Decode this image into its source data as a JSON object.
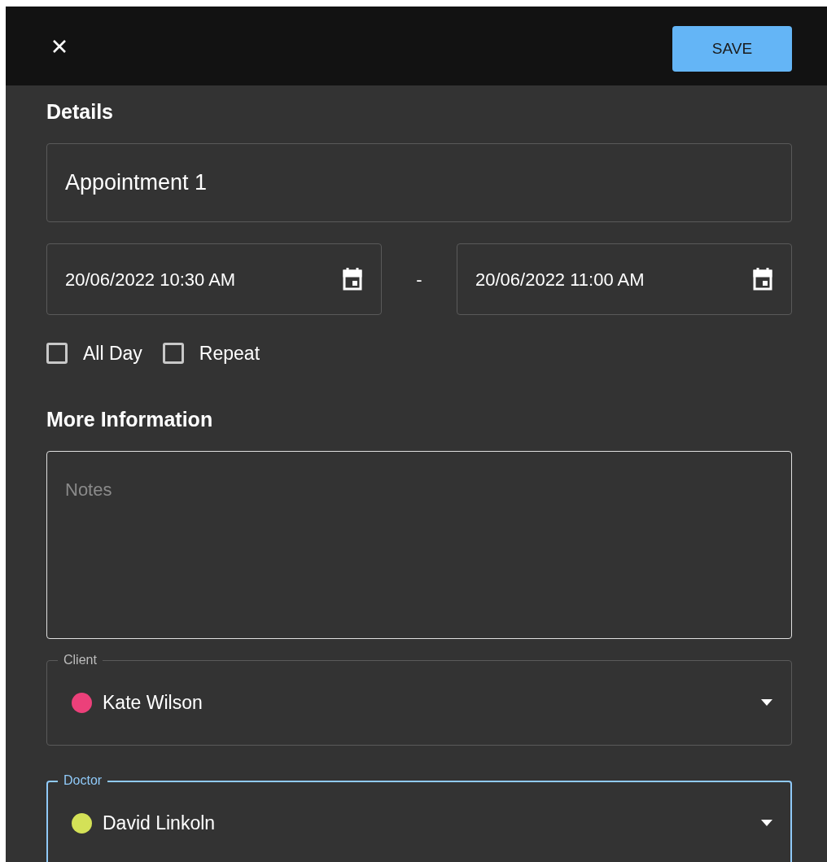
{
  "toolbar": {
    "save_button": "SAVE"
  },
  "details": {
    "heading": "Details",
    "title_value": "Appointment 1",
    "start": "20/06/2022 10:30 AM",
    "separator": "-",
    "end": "20/06/2022 11:00 AM",
    "options": [
      {
        "label": "All Day",
        "checked": false
      },
      {
        "label": "Repeat",
        "checked": false
      }
    ]
  },
  "more_information": {
    "heading": "More Information",
    "notes": {
      "placeholder": "Notes"
    },
    "selects": [
      {
        "label": "Client",
        "value": "Kate Wilson",
        "color": "#ec407a",
        "focused": false
      },
      {
        "label": "Doctor",
        "value": "David Linkoln",
        "color": "#d4e157",
        "focused": true
      }
    ]
  }
}
